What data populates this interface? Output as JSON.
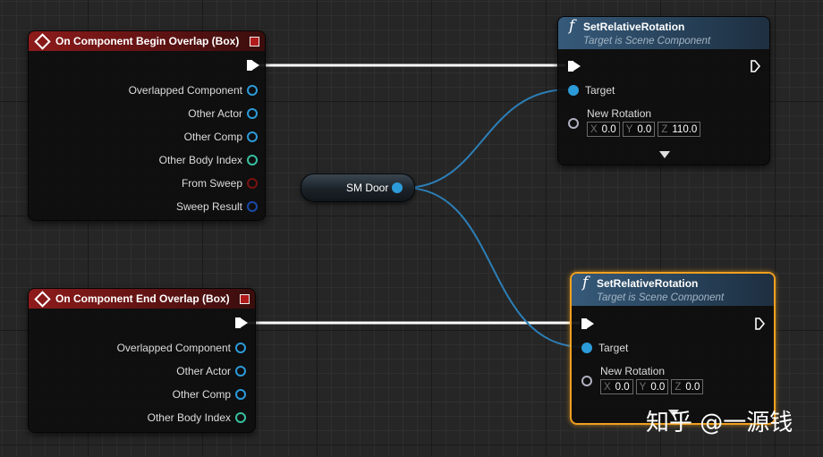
{
  "nodes": {
    "begin_overlap": {
      "title": "On Component Begin Overlap (Box)",
      "pins": [
        "Overlapped Component",
        "Other Actor",
        "Other Comp",
        "Other Body Index",
        "From Sweep",
        "Sweep Result"
      ]
    },
    "end_overlap": {
      "title": "On Component End Overlap (Box)",
      "pins": [
        "Overlapped Component",
        "Other Actor",
        "Other Comp",
        "Other Body Index"
      ]
    },
    "set_rotation_1": {
      "func_glyph": "f",
      "title": "SetRelativeRotation",
      "subtitle": "Target is Scene Component",
      "target_label": "Target",
      "rotation_label": "New Rotation",
      "x_axis": "X",
      "x": "0.0",
      "y_axis": "Y",
      "y": "0.0",
      "z_axis": "Z",
      "z": "110.0"
    },
    "set_rotation_2": {
      "func_glyph": "f",
      "title": "SetRelativeRotation",
      "subtitle": "Target is Scene Component",
      "target_label": "Target",
      "rotation_label": "New Rotation",
      "x_axis": "X",
      "x": "0.0",
      "y_axis": "Y",
      "y": "0.0",
      "z_axis": "Z",
      "z": "0.0"
    },
    "sm_door": {
      "label": "SM Door"
    }
  },
  "colors": {
    "event_header": "#8e1b1b",
    "function_header": "#365a7a",
    "object_pin": "#2c9bd9",
    "int_pin": "#38c0a0",
    "bool_pin": "#7a1212",
    "struct_pin": "#1a4aa8",
    "exec_wire": "#ffffff",
    "selection": "#f0a020"
  },
  "icons": {
    "event": "diamond-event-icon",
    "function": "function-f-icon",
    "exec": "exec-arrow-icon",
    "expand": "chevron-down-icon"
  },
  "watermark": "知乎 @一源钱"
}
